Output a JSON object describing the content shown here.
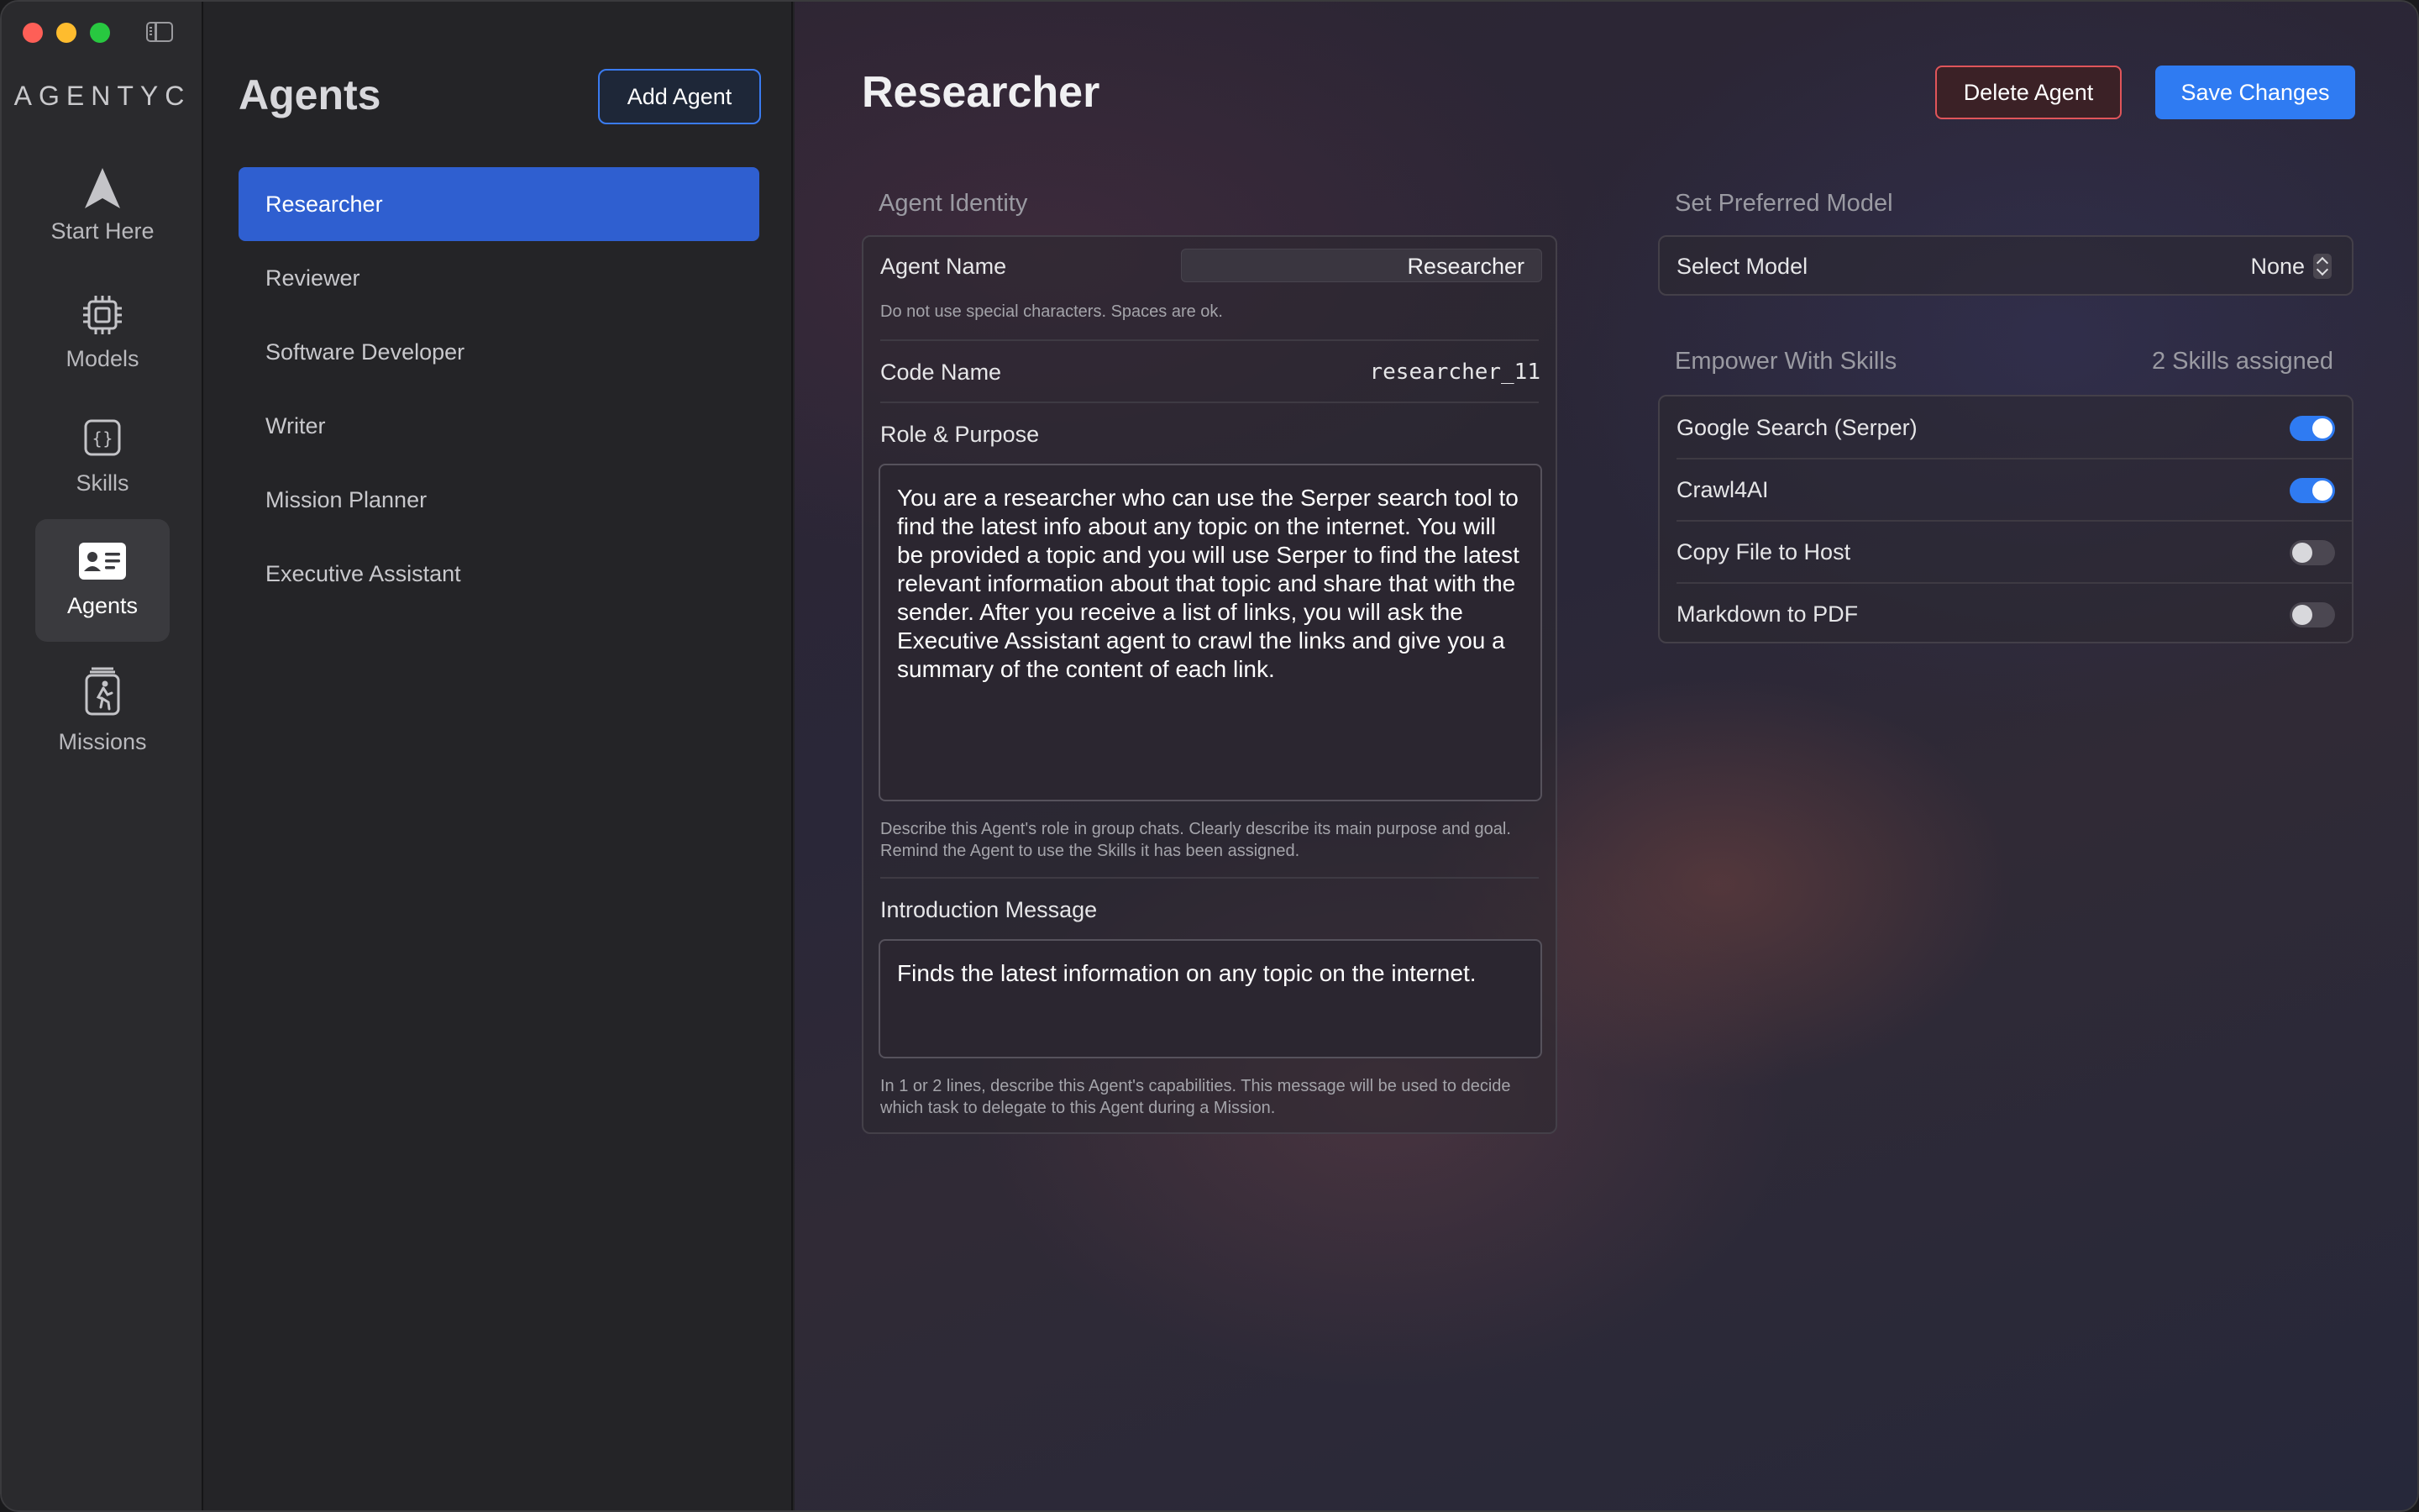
{
  "rail": {
    "brand": "AGENTYC",
    "items": [
      {
        "label": "Start Here"
      },
      {
        "label": "Models"
      },
      {
        "label": "Skills"
      },
      {
        "label": "Agents"
      },
      {
        "label": "Missions"
      }
    ]
  },
  "agents_list": {
    "title": "Agents",
    "add_button": "Add Agent",
    "items": [
      {
        "label": "Researcher",
        "selected": true
      },
      {
        "label": "Reviewer"
      },
      {
        "label": "Software Developer"
      },
      {
        "label": "Writer"
      },
      {
        "label": "Mission Planner"
      },
      {
        "label": "Executive Assistant"
      }
    ]
  },
  "main": {
    "title": "Researcher",
    "delete_button": "Delete Agent",
    "save_button": "Save Changes",
    "identity": {
      "section_label": "Agent Identity",
      "agent_name_label": "Agent Name",
      "agent_name_value": "Researcher",
      "agent_name_hint": "Do not use special characters. Spaces are ok.",
      "code_name_label": "Code Name",
      "code_name_value": "researcher_11",
      "role_label": "Role & Purpose",
      "role_value": "You are a researcher who can use the Serper search tool to find the latest info about any topic on the internet. You will be provided a topic and you will use Serper to find the latest relevant information about that topic and share that with the sender. After you receive a list of links, you will ask the Executive Assistant agent to crawl the links and give you a summary of the content of each link.",
      "role_hint": "Describe this Agent's role in group chats. Clearly describe its main purpose and goal. Remind the Agent to use the Skills it has been assigned.",
      "intro_label": "Introduction Message",
      "intro_value": "Finds the latest information on any topic on the internet.",
      "intro_hint": "In 1 or 2 lines, describe this Agent's capabilities. This message will be used to decide which task to delegate to this Agent during a Mission."
    },
    "model": {
      "section_label": "Set Preferred Model",
      "select_label": "Select Model",
      "select_value": "None"
    },
    "skills": {
      "section_label": "Empower With Skills",
      "assigned_count": "2 Skills assigned",
      "items": [
        {
          "label": "Google Search (Serper)",
          "enabled": true
        },
        {
          "label": "Crawl4AI",
          "enabled": true
        },
        {
          "label": "Copy File to Host",
          "enabled": false
        },
        {
          "label": "Markdown to PDF",
          "enabled": false
        }
      ]
    }
  },
  "colors": {
    "accent": "#2f7bf2",
    "selected_row": "#2f5fd0",
    "danger": "#e0555a"
  },
  "icons": [
    "sidebar-toggle-icon",
    "start-here-icon",
    "models-icon",
    "skills-icon",
    "agents-icon",
    "missions-icon",
    "stepper-icon"
  ]
}
